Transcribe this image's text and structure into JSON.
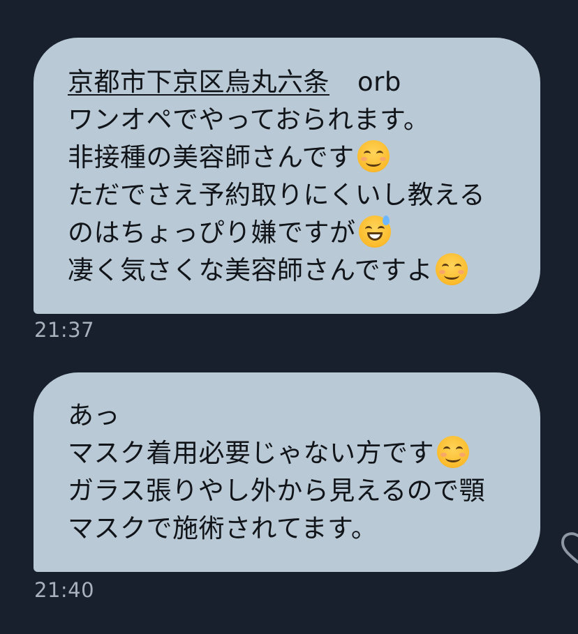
{
  "messages": [
    {
      "link": "京都市下京区烏丸六条",
      "line1_suffix": "orb",
      "line2": "ワンオペでやっておられます。",
      "line3": "非接種の美容師さんです",
      "line4": "ただでさえ予約取りにくいし教える",
      "line5": "のはちょっぴり嫌ですが",
      "line6": "凄く気さくな美容師さんですよ",
      "time": "21:37"
    },
    {
      "line1": "あっ",
      "line2": "マスク着用必要じゃない方です",
      "line3": "ガラス張りやし外から見えるので顎",
      "line4": "マスクで施術されてます。",
      "time": "21:40"
    }
  ],
  "colors": {
    "background": "#17202c",
    "bubble": "#b9c9d6",
    "text": "#111418",
    "timestamp": "#a7b2bd"
  },
  "icons": {
    "smile": "smiling-face-icon",
    "sweat": "grinning-sweat-icon",
    "side": "heart-outline-icon"
  }
}
